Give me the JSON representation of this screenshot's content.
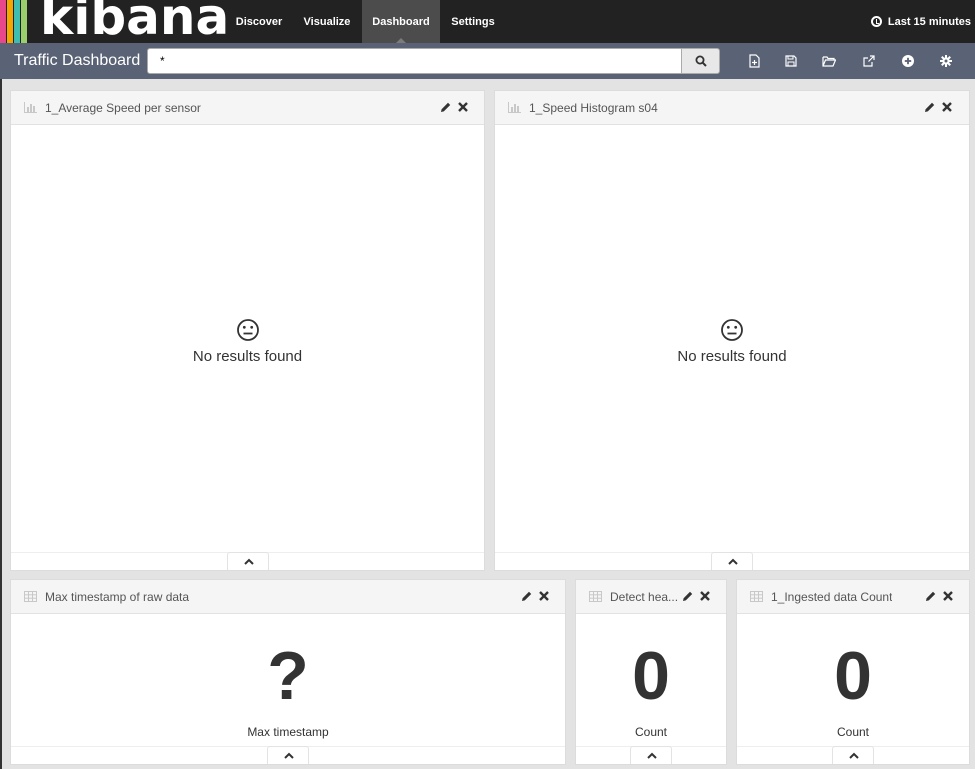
{
  "brand": {
    "logo_text": "kibana",
    "stripe_colors": [
      "#e8478b",
      "#f5a700",
      "#3ebeb0",
      "#9ad06b"
    ]
  },
  "nav": {
    "items": [
      {
        "label": "Discover"
      },
      {
        "label": "Visualize"
      },
      {
        "label": "Dashboard"
      },
      {
        "label": "Settings"
      }
    ],
    "active": "Dashboard",
    "time_range": "Last 15 minutes"
  },
  "toolbar": {
    "dashboard_title": "Traffic Dashboard",
    "query": "*",
    "icons": [
      "new-dashboard-icon",
      "save-icon",
      "open-folder-icon",
      "share-icon",
      "add-visualization-icon",
      "settings-gear-icon"
    ]
  },
  "panels": [
    {
      "title": "1_Average Speed per sensor",
      "type_icon": "bar-chart-icon",
      "state": "No results found"
    },
    {
      "title": "1_Speed Histogram s04",
      "type_icon": "bar-chart-icon",
      "state": "No results found"
    },
    {
      "title": "Max timestamp of raw data",
      "type_icon": "metric-grid-icon",
      "value": "?",
      "label": "Max timestamp"
    },
    {
      "title": "Detect hea...",
      "type_icon": "metric-grid-icon",
      "value": "0",
      "label": "Count"
    },
    {
      "title": "1_Ingested data Count",
      "type_icon": "metric-grid-icon",
      "value": "0",
      "label": "Count"
    }
  ],
  "colors": {
    "topbar": "#222222",
    "subbar": "#5a6375",
    "active_tab": "#4c4c4c"
  }
}
